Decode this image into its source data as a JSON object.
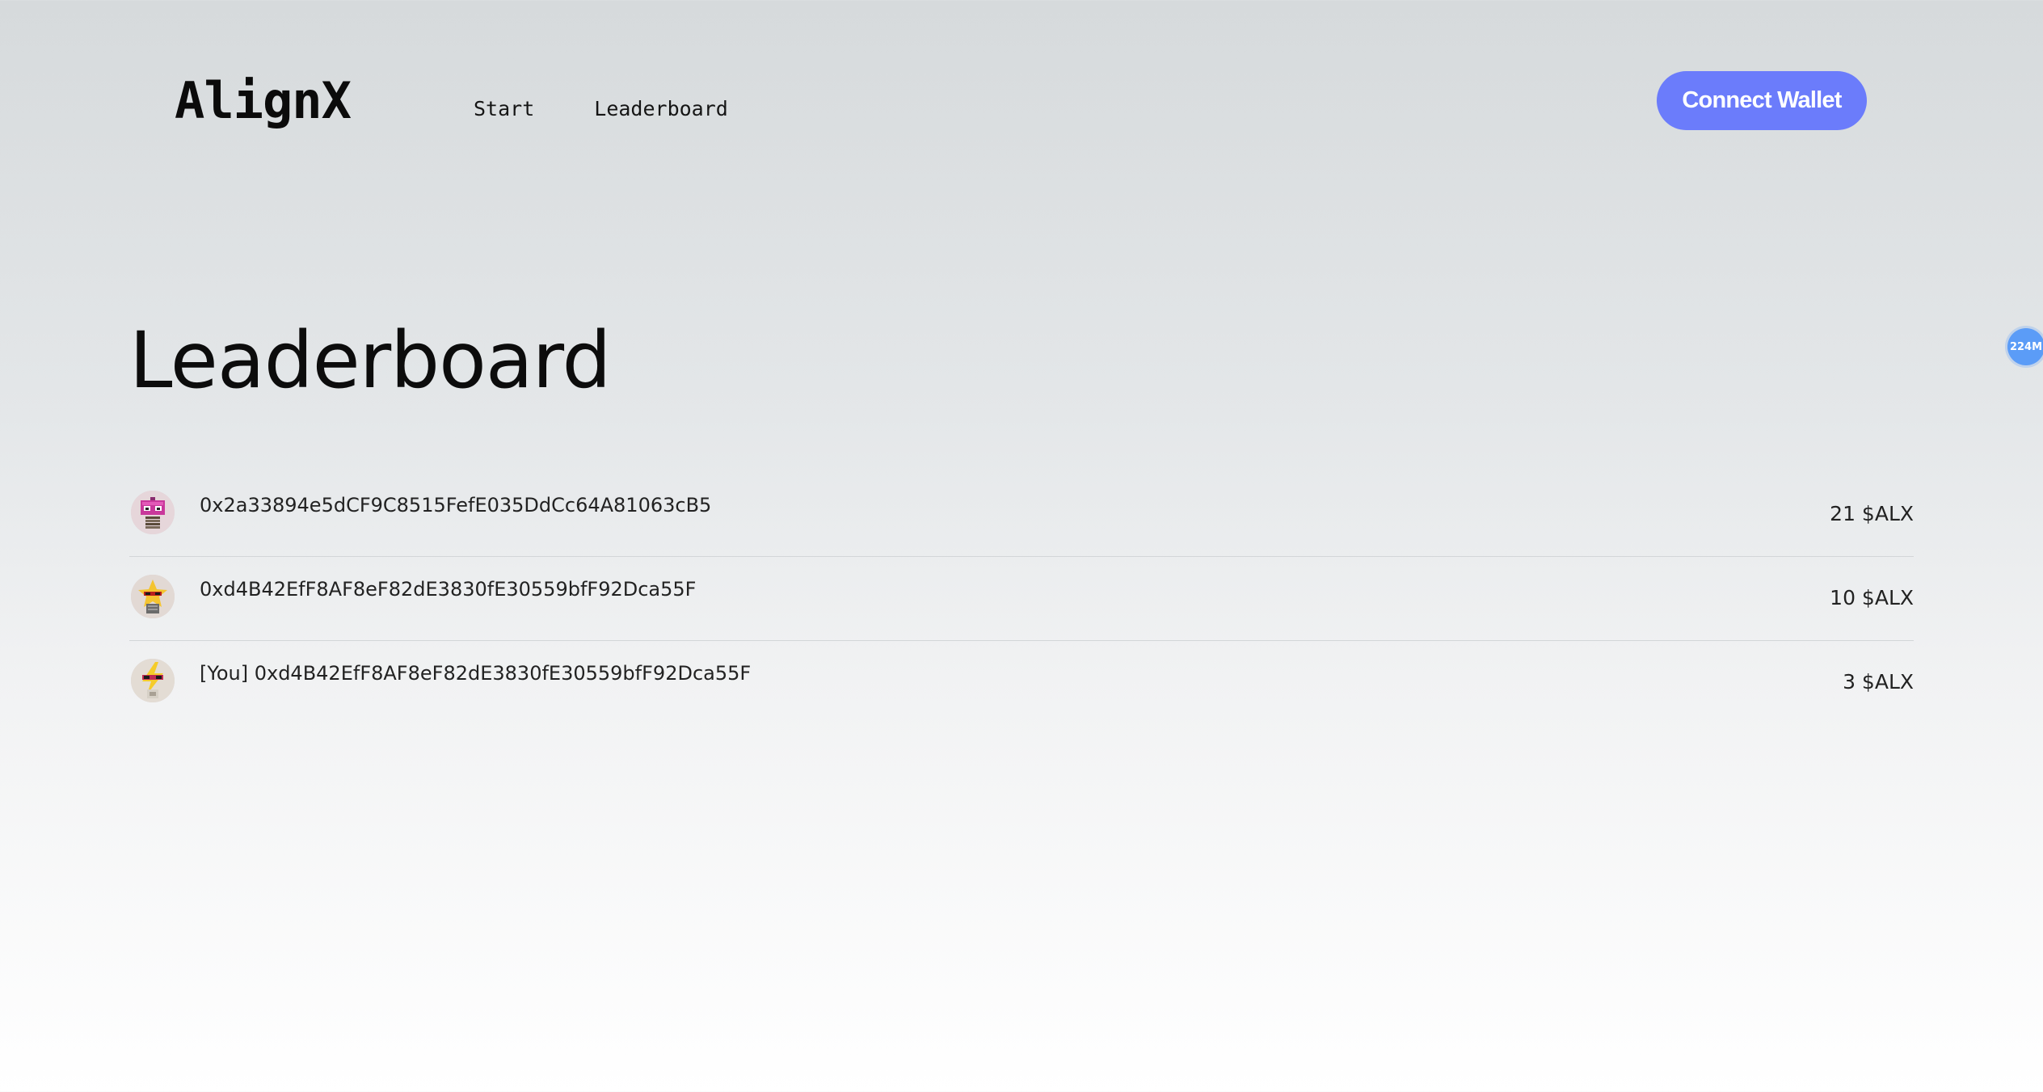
{
  "header": {
    "logo": "AlignX",
    "nav": [
      {
        "label": "Start"
      },
      {
        "label": "Leaderboard"
      }
    ],
    "connect_label": "Connect Wallet",
    "accent": "#6b7cfb"
  },
  "floating_badge": {
    "label": "224M",
    "color": "#5b9cf7"
  },
  "page_title": "Leaderboard",
  "leaderboard": [
    {
      "address": "0x2a33894e5dCF9C8515FefE035DdCc64A81063cB5",
      "score": "21 $ALX",
      "avatar": "pink-robot-avatar-icon"
    },
    {
      "address": "0xd4B42EfF8AF8eF82dE3830fE30559bfF92Dca55F",
      "score": "10 $ALX",
      "avatar": "star-sunglasses-avatar-icon"
    },
    {
      "address": "[You] 0xd4B42EfF8AF8eF82dE3830fE30559bfF92Dca55F",
      "score": "3 $ALX",
      "avatar": "lightning-sunglasses-avatar-icon"
    }
  ]
}
